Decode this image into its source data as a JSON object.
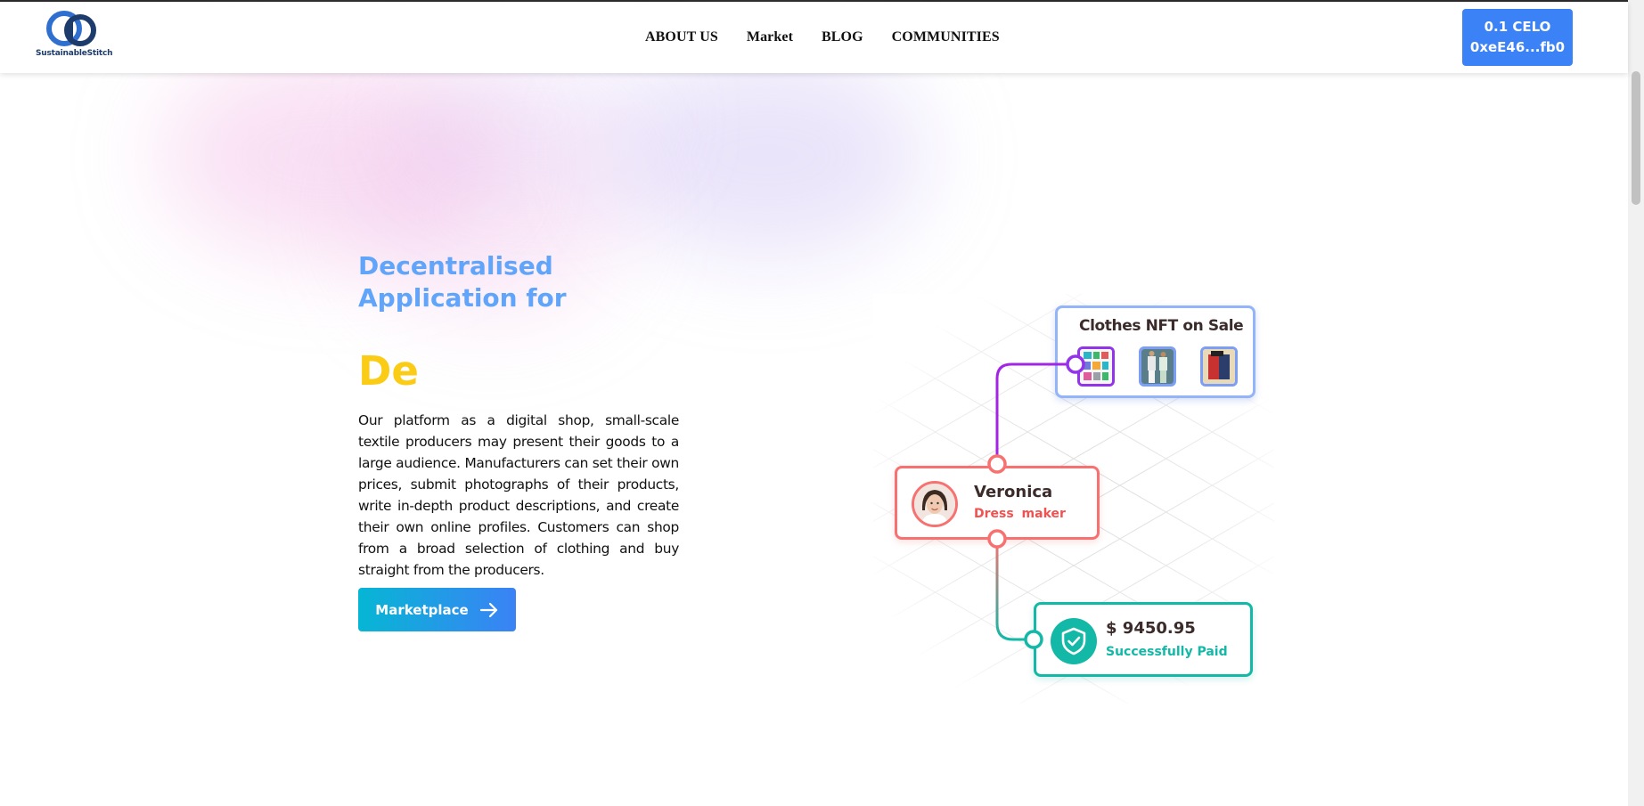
{
  "brand": {
    "name": "SustainableStitch"
  },
  "nav": {
    "links": [
      "ABOUT US",
      "Market",
      "BLOG",
      "COMMUNITIES"
    ],
    "wallet": {
      "balance": "0.1 CELO",
      "address": "0xeE46...fb0"
    }
  },
  "hero": {
    "title": "Decentralised Application for",
    "typed_text": "De",
    "description": "Our platform as a digital shop, small-scale textile producers may present their goods to a large audience. Manufacturers can set their own prices, submit photographs of their products, write in-depth product descriptions, and create their own online profiles. Customers can shop from a broad selection of clothing and buy straight from the producers.",
    "button_label": "Marketplace"
  },
  "illustration": {
    "nft_card": {
      "title": "Clothes NFT  on Sale"
    },
    "person_card": {
      "name": "Veronica",
      "role": "Dress maker"
    },
    "payment_card": {
      "amount": "$ 9450.95",
      "status": "Successfully Paid"
    },
    "colors": {
      "nft": "#9333ea",
      "person": "#f87171",
      "payment": "#14b8a6"
    }
  },
  "icons": {
    "wallet_arrow": "arrow-right-icon",
    "shield": "shield-check-icon"
  }
}
